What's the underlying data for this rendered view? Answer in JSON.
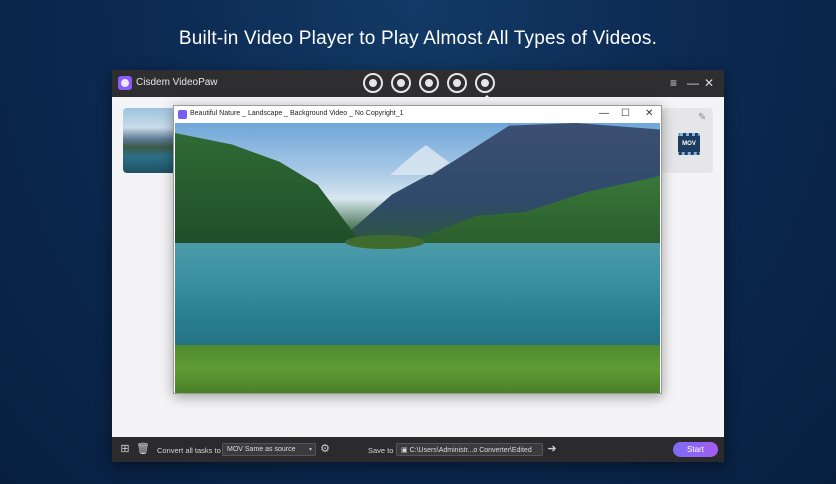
{
  "headline": "Built-in Video Player to Play Almost All Types of Videos.",
  "app": {
    "title": "Cisdem VideoPaw",
    "toolbar_icons": [
      "convert-icon",
      "compress-icon",
      "edit-icon",
      "merge-icon",
      "player-icon"
    ],
    "window_controls": [
      "≡",
      "—",
      "✕"
    ]
  },
  "task": {
    "format_badge": "MOV"
  },
  "player": {
    "title": "Beautiful Nature _ Landscape _ Background Video _ No Copyright_1",
    "controls": [
      "—",
      "☐",
      "✕"
    ]
  },
  "bottom": {
    "convert_label": "Convert all tasks to",
    "format_value": "MOV Same as source",
    "save_label": "Save to",
    "save_path": "C:\\Users\\Administr...o Converter\\Edited",
    "start_label": "Start"
  }
}
